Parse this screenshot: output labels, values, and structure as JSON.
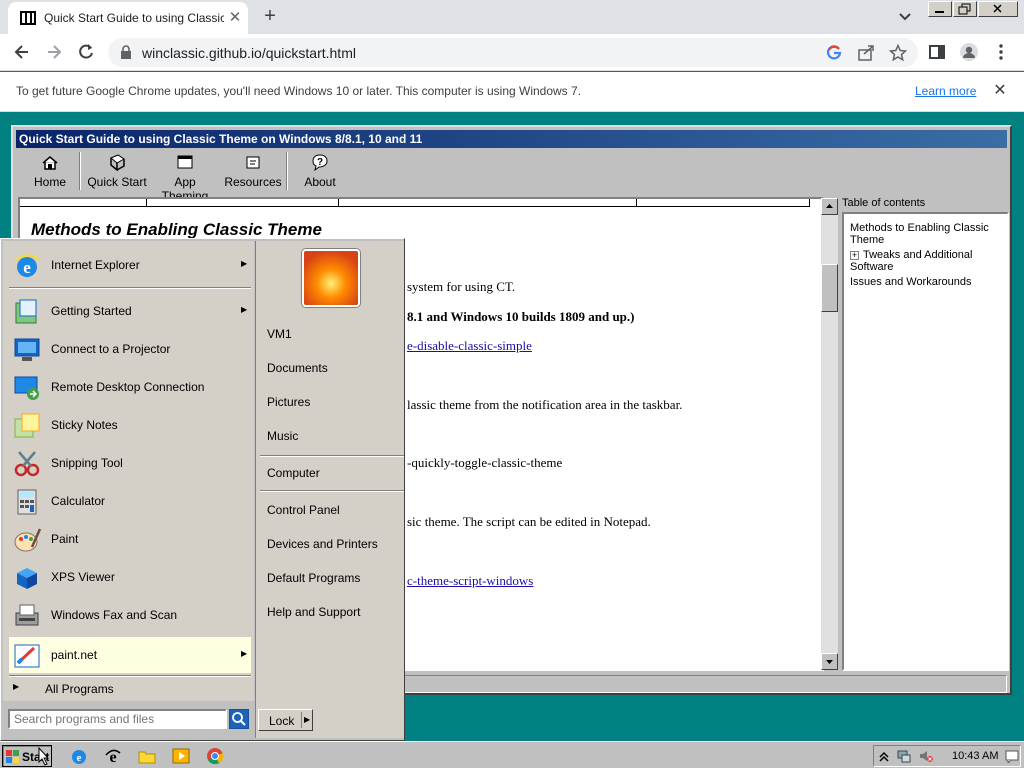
{
  "browser": {
    "tab_title": "Quick Start Guide to using Classic T",
    "url": "winclassic.github.io/quickstart.html",
    "infobar_text": "To get future Google Chrome updates, you'll need Windows 10 or later. This computer is using Windows 7.",
    "learn_more": "Learn more",
    "tab_close": "✕",
    "new_tab": "+",
    "infobar_close": "✕"
  },
  "app": {
    "title": "Quick Start Guide to using Classic Theme on Windows 8/8.1, 10 and 11",
    "toolbar": [
      {
        "label": "Home",
        "icon": "home-icon"
      },
      {
        "label": "Quick Start",
        "icon": "book-icon"
      },
      {
        "label": "App Theming",
        "icon": "window-icon"
      },
      {
        "label": "Resources",
        "icon": "resources-icon"
      },
      {
        "label": "About",
        "icon": "help-icon"
      }
    ],
    "heading": "Methods to Enabling Classic Theme",
    "lines": [
      "system for using CT.",
      "8.1 and Windows 10 builds 1809 and up.)",
      "e-disable-classic-simple",
      "lassic theme from the notification area in the taskbar.",
      "-quickly-toggle-classic-theme",
      "sic theme. The script can be edited in Notepad.",
      "c-theme-script-windows"
    ],
    "toc_title": "Table of contents",
    "toc": [
      {
        "label": "Methods to Enabling Classic Theme",
        "expand": ""
      },
      {
        "label": "Tweaks and Additional Software",
        "expand": "+"
      },
      {
        "label": "Issues and Workarounds",
        "expand": ""
      }
    ]
  },
  "start_menu": {
    "programs": [
      {
        "label": "Internet Explorer",
        "icon": "internet-explorer-icon",
        "arrow": "▶"
      },
      {
        "label": "Getting Started",
        "icon": "getting-started-icon",
        "arrow": "▶"
      },
      {
        "label": "Connect to a Projector",
        "icon": "projector-icon",
        "arrow": ""
      },
      {
        "label": "Remote Desktop Connection",
        "icon": "remote-desktop-icon",
        "arrow": ""
      },
      {
        "label": "Sticky Notes",
        "icon": "sticky-notes-icon",
        "arrow": ""
      },
      {
        "label": "Snipping Tool",
        "icon": "snipping-tool-icon",
        "arrow": ""
      },
      {
        "label": "Calculator",
        "icon": "calculator-icon",
        "arrow": ""
      },
      {
        "label": "Paint",
        "icon": "paint-icon",
        "arrow": ""
      },
      {
        "label": "XPS Viewer",
        "icon": "xps-viewer-icon",
        "arrow": ""
      },
      {
        "label": "Windows Fax and Scan",
        "icon": "fax-scan-icon",
        "arrow": ""
      },
      {
        "label": "paint.net",
        "icon": "paint-net-icon",
        "arrow": "▶"
      }
    ],
    "all_programs": "All Programs",
    "all_programs_arrow": "▶",
    "search_placeholder": "Search programs and files",
    "right_items": [
      {
        "label": "VM1"
      },
      {
        "label": "Documents"
      },
      {
        "label": "Pictures"
      },
      {
        "label": "Music"
      },
      {
        "label": "Computer"
      },
      {
        "label": "Control Panel"
      },
      {
        "label": "Devices and Printers"
      },
      {
        "label": "Default Programs"
      },
      {
        "label": "Help and Support"
      }
    ],
    "lock_label": "Lock",
    "lock_arrow": "▶"
  },
  "taskbar": {
    "start_label": "Start",
    "clock": "10:43 AM",
    "quick_launch": [
      "internet-explorer-icon",
      "ie-icon",
      "folder-icon",
      "media-player-icon",
      "chrome-icon"
    ]
  },
  "colors": {
    "desktop": "#008080",
    "title_bar": "#0a246a",
    "link": "#1a0dab"
  }
}
